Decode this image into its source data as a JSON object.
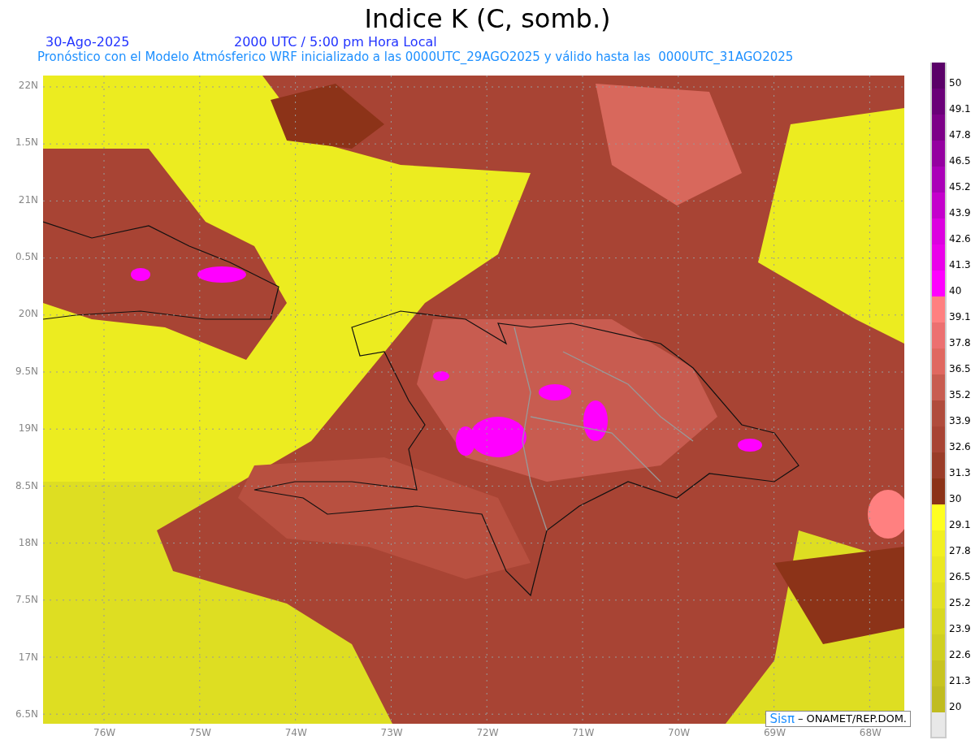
{
  "title": "Indice K (C, somb.)",
  "date": "30-Ago-2025",
  "time": "2000 UTC / 5:00 pm Hora Local",
  "forecast": "Pronóstico con el Modelo Atmósferico WRF inicializado a las 0000UTC_29AGO2025 y válido hasta las  0000UTC_31AGO2025",
  "y_axis": [
    "22N",
    "1.5N",
    "21N",
    "0.5N",
    "20N",
    "9.5N",
    "19N",
    "8.5N",
    "18N",
    "7.5N",
    "17N",
    "6.5N"
  ],
  "x_axis": [
    "76W",
    "75W",
    "74W",
    "73W",
    "72W",
    "71W",
    "70W",
    "69W",
    "68W"
  ],
  "colorbar": [
    {
      "label": "50",
      "color": "#5a0068"
    },
    {
      "label": "49.1",
      "color": "#6a0078"
    },
    {
      "label": "47.8",
      "color": "#7d0088"
    },
    {
      "label": "46.5",
      "color": "#9400a0"
    },
    {
      "label": "45.2",
      "color": "#aa00b8"
    },
    {
      "label": "43.9",
      "color": "#c400cc"
    },
    {
      "label": "42.6",
      "color": "#dc00e0"
    },
    {
      "label": "41.3",
      "color": "#ea00ea"
    },
    {
      "label": "40",
      "color": "#ff00ff"
    },
    {
      "label": "39.1",
      "color": "#ff8080"
    },
    {
      "label": "37.8",
      "color": "#ec7070"
    },
    {
      "label": "36.5",
      "color": "#e06860"
    },
    {
      "label": "35.2",
      "color": "#c85c50"
    },
    {
      "label": "33.9",
      "color": "#b04c3c"
    },
    {
      "label": "32.6",
      "color": "#a84434"
    },
    {
      "label": "31.3",
      "color": "#9a3c28"
    },
    {
      "label": "30",
      "color": "#8c3318"
    },
    {
      "label": "29.1",
      "color": "#ffff20"
    },
    {
      "label": "27.8",
      "color": "#f2f020"
    },
    {
      "label": "26.5",
      "color": "#ebe820"
    },
    {
      "label": "25.2",
      "color": "#e2e020"
    },
    {
      "label": "23.9",
      "color": "#d8d820"
    },
    {
      "label": "22.6",
      "color": "#d0d020"
    },
    {
      "label": "21.3",
      "color": "#c8c420"
    },
    {
      "label": "20",
      "color": "#c0bc20"
    }
  ],
  "credit": {
    "logo": "Sisπ",
    "text": "– ONAMET/REP.DOM."
  }
}
